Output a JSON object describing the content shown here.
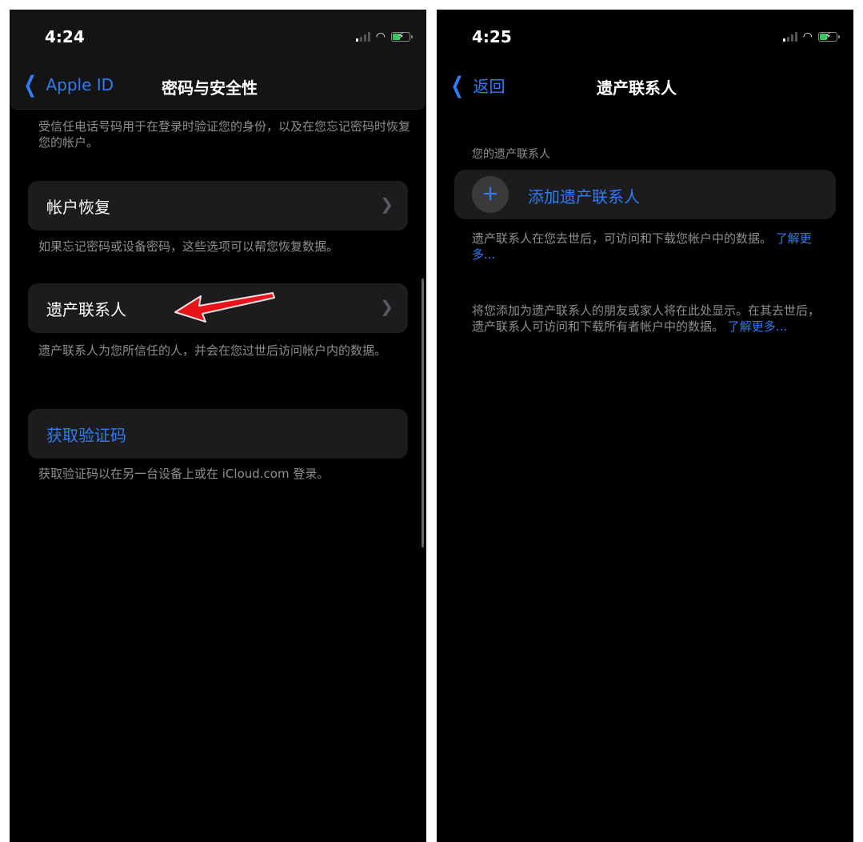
{
  "left": {
    "status": {
      "time": "4:24"
    },
    "nav": {
      "back_label": "Apple ID",
      "title": "密码与安全性"
    },
    "trusted_phone_footer": "受信任电话号码用于在登录时验证您的身份，以及在您忘记密码时恢复您的帐户。",
    "cells": [
      {
        "label": "帐户恢复",
        "footer": "如果忘记密码或设备密码，这些选项可以帮您恢复数据。"
      },
      {
        "label": "遗产联系人",
        "footer": "遗产联系人为您所信任的人，并会在您过世后访问帐户内的数据。"
      },
      {
        "label": "获取验证码",
        "footer": "获取验证码以在另一台设备上或在 iCloud.com 登录。"
      }
    ],
    "annotation": "red-arrow-pointing-to-legacy-contact"
  },
  "right": {
    "status": {
      "time": "4:25"
    },
    "nav": {
      "back_label": "返回",
      "title": "遗产联系人"
    },
    "section_header": "您的遗产联系人",
    "add_button": {
      "icon": "+",
      "label": "添加遗产联系人"
    },
    "footer1": {
      "text": "遗产联系人在您去世后，可访问和下载您帐户中的数据。",
      "link": "了解更多..."
    },
    "footer2": {
      "text": "将您添加为遗产联系人的朋友或家人将在此处显示。在其去世后，遗产联系人可访问和下载所有者帐户中的数据。",
      "link": "了解更多..."
    }
  },
  "colors": {
    "accent": "#2f7cf6",
    "cell_bg": "#1c1c1e",
    "footer_text": "#8e8e93",
    "arrow": "#e8141c"
  }
}
